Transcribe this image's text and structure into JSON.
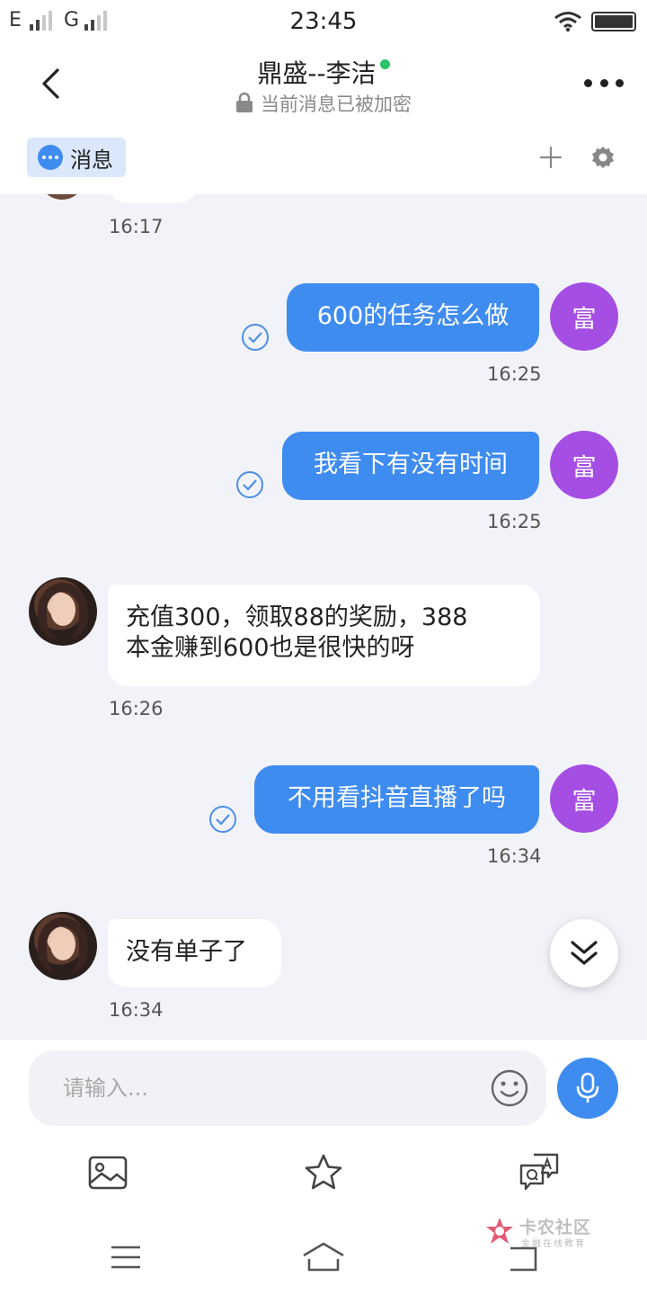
{
  "status_bar": {
    "carrier_1": "E",
    "carrier_2": "G",
    "time": "23:45",
    "icons": [
      "signal-icon",
      "wifi-icon",
      "battery-icon"
    ]
  },
  "header": {
    "title": "鼎盛--李洁",
    "subtitle": "当前消息已被加密",
    "online_color": "#2cc46b",
    "icons": [
      "back-arrow-icon",
      "lock-icon",
      "more-dots-icon"
    ]
  },
  "tabs": {
    "active_label": "消息",
    "icons": [
      "chat-bubble-icon",
      "plus-icon",
      "gear-icon"
    ]
  },
  "messages": [
    {
      "side": "in",
      "text": "",
      "time": "16:17",
      "partial": true
    },
    {
      "side": "out",
      "text": "600的任务怎么做",
      "time": "16:25",
      "avatar_text": "富",
      "read": true
    },
    {
      "side": "out",
      "text": "我看下有没有时间",
      "time": "16:25",
      "avatar_text": "富",
      "read": true
    },
    {
      "side": "in",
      "lines": [
        "充值300，领取88的奖励，388",
        "本金赚到600也是很快的呀"
      ],
      "time": "16:26"
    },
    {
      "side": "out",
      "text": "不用看抖音直播了吗",
      "time": "16:34",
      "avatar_text": "富",
      "read": true
    },
    {
      "side": "in",
      "text": "没有单子了",
      "time": "16:34"
    }
  ],
  "input": {
    "placeholder": "请输入...",
    "icons": [
      "emoji-icon",
      "microphone-icon"
    ]
  },
  "toolbar": {
    "icons": [
      "image-icon",
      "star-icon",
      "translate-icon"
    ]
  },
  "nav": {
    "icons": [
      "menu-icon",
      "home-icon",
      "back-icon"
    ]
  },
  "watermark": {
    "title": "卡农社区",
    "subtitle": "金融在线教育"
  },
  "colors": {
    "accent": "#3f8cf1",
    "my_avatar": "#a54ee3",
    "background": "#f2f3f8"
  }
}
